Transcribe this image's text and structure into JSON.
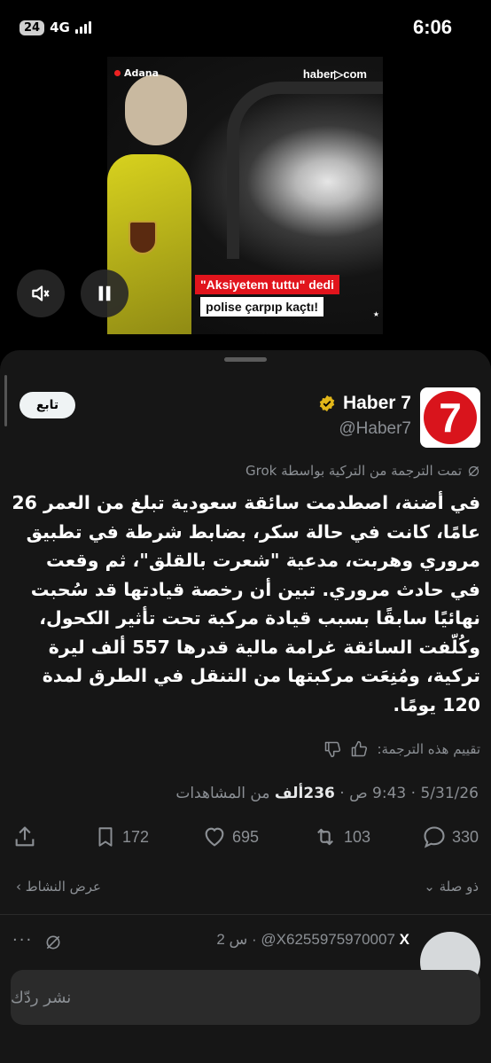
{
  "status_bar": {
    "battery": "24",
    "network": "4G",
    "time": "6:06"
  },
  "video": {
    "location": "Adana",
    "brand": "haber▷com",
    "caption_line1": "\"Aksiyetem tuttu\" dedi",
    "caption_line2": "polise çarpıp kaçtı!",
    "watermark": "★"
  },
  "tweet": {
    "follow_label": "تابع",
    "author_name": "Haber 7",
    "author_handle": "@Haber7",
    "avatar_glyph": "7",
    "translation_note": "تمت الترجمة من التركية بواسطة Grok",
    "text": "في أضنة، اصطدمت سائقة سعودية تبلغ من العمر 26 عامًا، كانت في حالة سكر، بضابط شرطة في تطبيق مروري وهربت، مدعية \"شعرت بالقلق\"، ثم وقعت في حادث مروري. تبين أن رخصة قيادتها قد سُحبت نهائيًا سابقًا بسبب قيادة مركبة تحت تأثير الكحول، وكُلّفت السائقة غرامة مالية قدرها 557 ألف ليرة تركية، ومُنِعَت مركبتها من التنقل في الطرق لمدة 120 يومًا.",
    "rate_label": "تقييم هذه الترجمة:",
    "date": "5/31/26",
    "time": "9:43 ص",
    "views_count": "236ألف",
    "views_label": "من المشاهدات",
    "replies": "330",
    "retweets": "103",
    "likes": "695",
    "bookmarks": "172",
    "related_label": "ذو صلة",
    "activity_label": "عرض النشاط"
  },
  "reply_preview": {
    "name": "X",
    "handle": "@X6255975970007",
    "age": "2 س"
  },
  "composer": {
    "placeholder": "نشر ردّك"
  }
}
